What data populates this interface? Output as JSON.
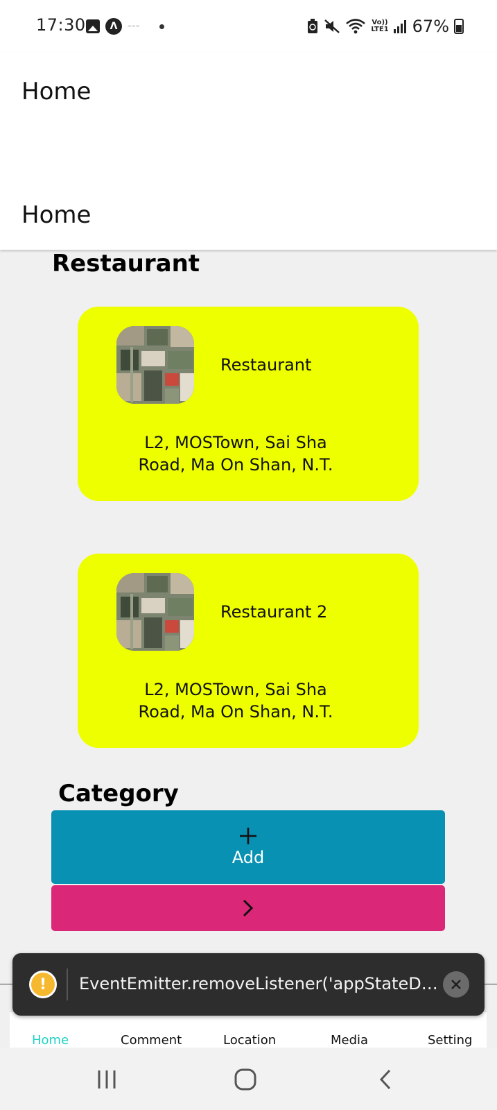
{
  "status_bar": {
    "time": "17:30",
    "notification_icons": [
      "image-icon",
      "app-icon",
      "tiny-app-icon",
      "dot-icon"
    ],
    "lte_label_top": "Vo))",
    "lte_label_bottom": "LTE1",
    "battery_percent": "67%",
    "battery_level": 0.67
  },
  "header": {
    "title_primary": "Home",
    "title_secondary": "Home"
  },
  "sections": {
    "restaurant_title": "Restaurant",
    "category_title": "Category"
  },
  "restaurants": [
    {
      "name": "Restaurant",
      "address_line1": "L2, MOSTown, Sai Sha",
      "address_line2": "Road, Ma On Shan, N.T."
    },
    {
      "name": "Restaurant 2",
      "address_line1": "L2, MOSTown, Sai Sha",
      "address_line2": "Road, Ma On Shan, N.T."
    }
  ],
  "category": {
    "add_icon": "plus-icon",
    "add_label": "Add",
    "next_icon": "chevron-right-icon"
  },
  "toast": {
    "icon": "warning-icon",
    "message": "EventEmitter.removeListener('appStateDid…",
    "close_icon": "close-icon"
  },
  "tabs": [
    {
      "label": "Home",
      "active": true
    },
    {
      "label": "Comment",
      "active": false
    },
    {
      "label": "Location",
      "active": false
    },
    {
      "label": "Media",
      "active": false
    },
    {
      "label": "Setting",
      "active": false
    }
  ],
  "colors": {
    "card_background": "#eeff00",
    "add_button": "#0891b2",
    "next_button": "#db2777",
    "active_tab": "#22d3c5",
    "toast_background": "#2d2d2d",
    "warning": "#f5b82e"
  },
  "system_nav": {
    "icons": [
      "recents-icon",
      "home-icon",
      "back-icon"
    ]
  }
}
